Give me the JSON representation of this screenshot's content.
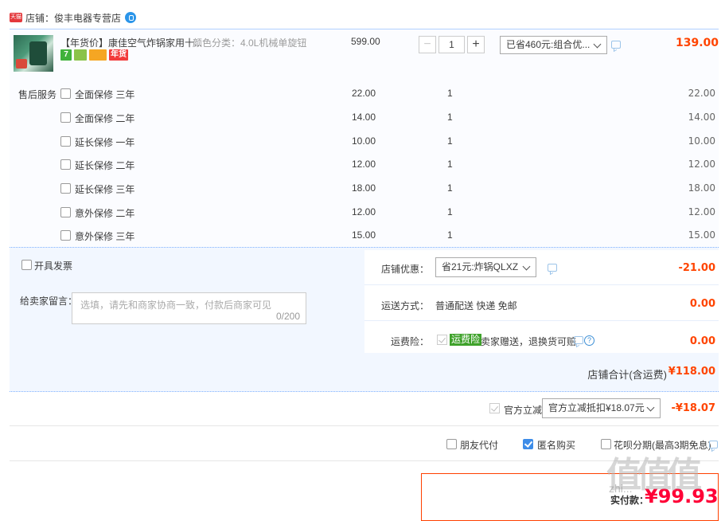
{
  "shop": {
    "logo_text": "天猫",
    "name": "店铺：俊丰电器专营店"
  },
  "item": {
    "title": "【年货价】康佳空气炸锅家用十...",
    "sku": "颜色分类：4.0L机械单旋钮",
    "badges": [
      "7",
      "",
      "",
      "年货"
    ],
    "unit_price": "599.00",
    "qty_minus": "−",
    "qty": "1",
    "qty_plus": "+",
    "promo": "已省460元:组合优...",
    "subtotal": "139.00"
  },
  "services": {
    "label": "售后服务",
    "rows": [
      {
        "name": "全面保修 三年",
        "price": "22.00",
        "qty": "1",
        "total": "22.00"
      },
      {
        "name": "全面保修 二年",
        "price": "14.00",
        "qty": "1",
        "total": "14.00"
      },
      {
        "name": "延长保修 一年",
        "price": "10.00",
        "qty": "1",
        "total": "10.00"
      },
      {
        "name": "延长保修 二年",
        "price": "12.00",
        "qty": "1",
        "total": "12.00"
      },
      {
        "name": "延长保修 三年",
        "price": "18.00",
        "qty": "1",
        "total": "18.00"
      },
      {
        "name": "意外保修 二年",
        "price": "12.00",
        "qty": "1",
        "total": "12.00"
      },
      {
        "name": "意外保修 三年",
        "price": "15.00",
        "qty": "1",
        "total": "15.00"
      }
    ]
  },
  "options": {
    "invoice": "开具发票",
    "memo_label": "给卖家留言：",
    "memo_placeholder": "选填，请先和商家协商一致，付款后商家可见",
    "memo_count": "0/200",
    "shop_discount_label": "店铺优惠：",
    "shop_discount_value": "省21元:炸锅QLXZ",
    "shop_discount_amount": "-21.00",
    "delivery_label": "运送方式：",
    "delivery_value": "普通配送 快递 免邮",
    "delivery_amount": "0.00",
    "freight_label": "运费险：",
    "freight_tag": "运费险",
    "freight_text": "卖家赠送，退换货可赔",
    "freight_amount": "0.00",
    "shop_total_label": "店铺合计(含运费)",
    "shop_total_value": "¥118.00"
  },
  "official": {
    "label": "官方立减",
    "select": "官方立减抵扣¥18.07元",
    "amount": "-¥18.07"
  },
  "checkout": {
    "friend_pay": "朋友代付",
    "anonymous": "匿名购买",
    "huabei": "花呗分期(最高3期免息)",
    "pay_label": "实付款：",
    "pay_amount": "¥99.93"
  },
  "watermark": {
    "logo": "值值值",
    "site": "zhi..."
  }
}
